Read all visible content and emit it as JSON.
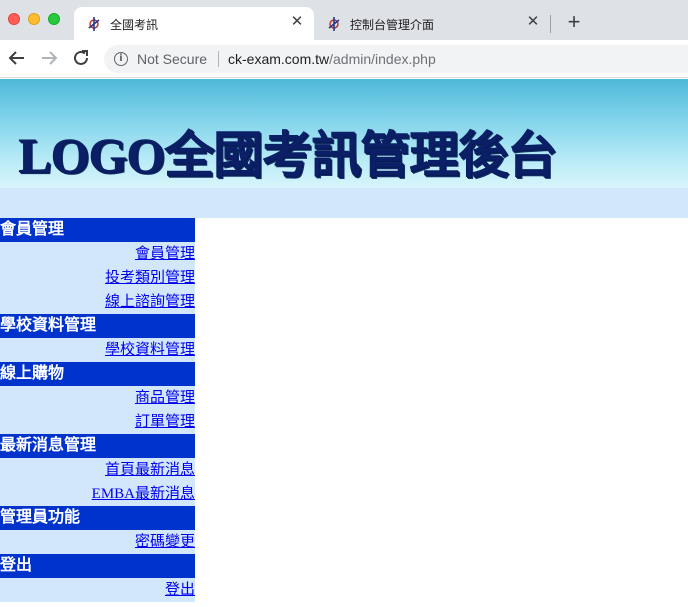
{
  "browser": {
    "tabs": [
      {
        "title": "全國考訊",
        "active": true
      },
      {
        "title": "控制台管理介面",
        "active": false
      }
    ],
    "new_tab_glyph": "+",
    "close_glyph": "✕",
    "security_label": "Not Secure",
    "url_host": "ck-exam.com.tw",
    "url_path": "/admin/index.php"
  },
  "page": {
    "banner_title": "LOGO全國考訊管理後台",
    "colors": {
      "banner_top": "#4fb9d9",
      "banner_bottom": "#d8f5fb",
      "menu_header": "#0033cc",
      "menu_bg": "#d2e6fc",
      "link": "#0000ee"
    }
  },
  "sidebar": [
    {
      "header": "會員管理",
      "items": [
        "會員管理",
        "投考類別管理",
        "線上諮詢管理"
      ]
    },
    {
      "header": "學校資料管理",
      "items": [
        "學校資料管理"
      ]
    },
    {
      "header": "線上購物",
      "items": [
        "商品管理",
        "訂單管理"
      ]
    },
    {
      "header": "最新消息管理",
      "items": [
        "首頁最新消息",
        "EMBA最新消息"
      ]
    },
    {
      "header": "管理員功能",
      "items": [
        "密碼變更"
      ]
    },
    {
      "header": "登出",
      "items": [
        "登出"
      ]
    }
  ]
}
